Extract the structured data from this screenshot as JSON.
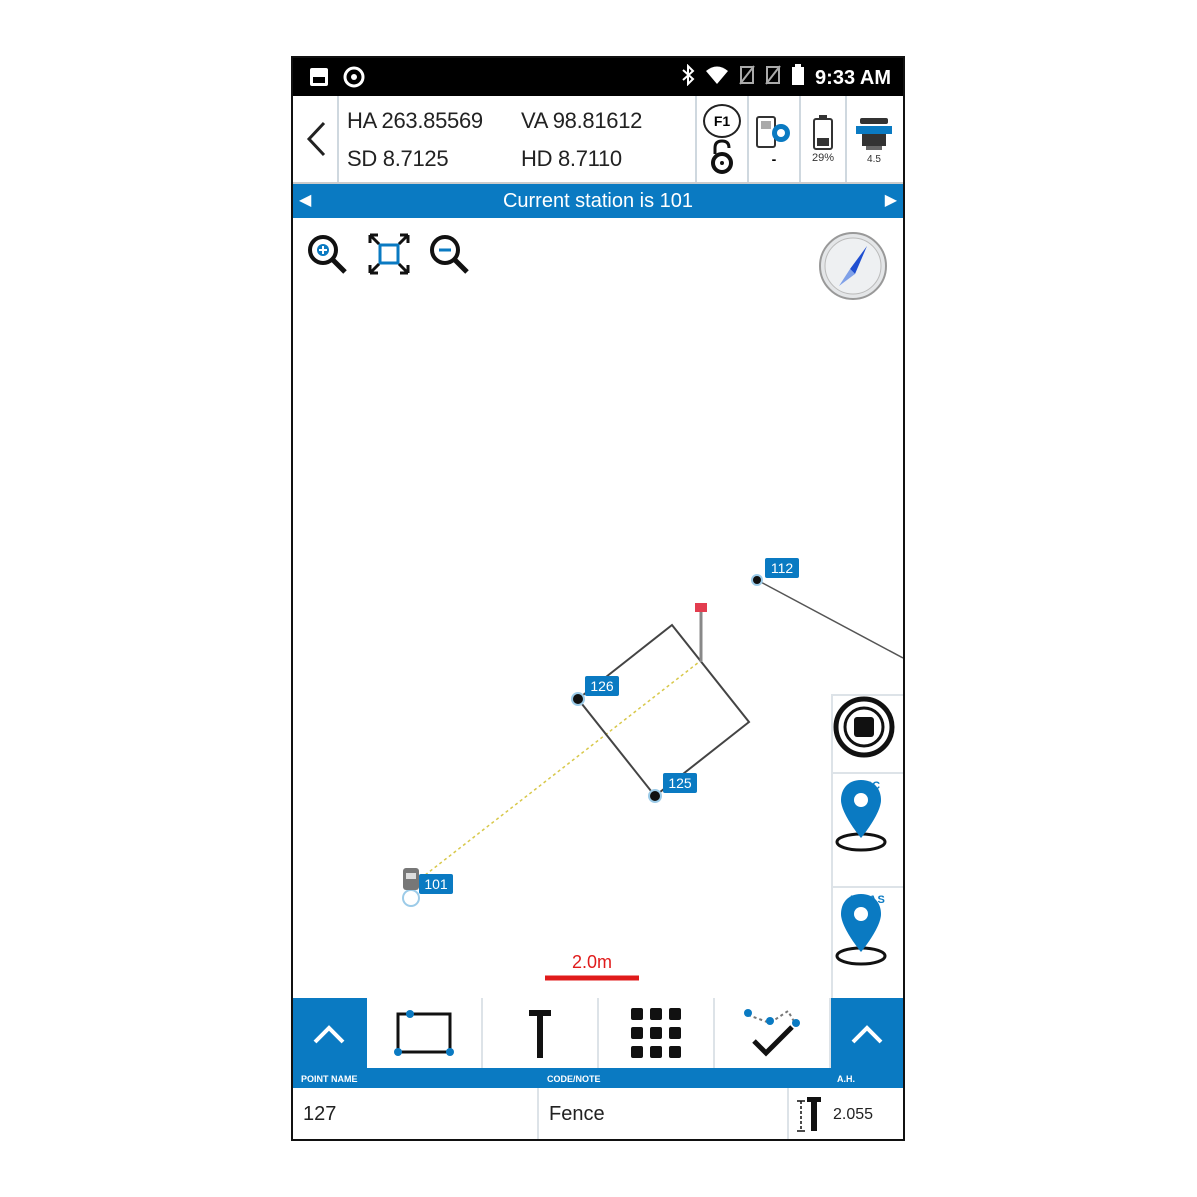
{
  "status_bar": {
    "time": "9:33 AM",
    "left_icons": [
      "image-icon",
      "target-icon"
    ],
    "right_icons": [
      "bluetooth-icon",
      "wifi-icon",
      "no-sim-icon",
      "no-sim-icon",
      "battery-icon"
    ]
  },
  "top_bar": {
    "ha": "HA 263.85569",
    "va": "VA 98.81612",
    "sd": "SD 8.7125",
    "hd": "HD 8.7110",
    "f1_label": "F1",
    "instrument_value": "-",
    "battery_percent": "29%",
    "prism_value": "4.5"
  },
  "station_bar": {
    "text": "Current station is 101"
  },
  "map": {
    "points": [
      {
        "name": "112"
      },
      {
        "name": "126"
      },
      {
        "name": "125"
      },
      {
        "name": "101"
      }
    ],
    "scale_label": "2.0m",
    "colors": {
      "accent": "#0a7ac2",
      "scale": "#e01b1b",
      "target": "#e33d4f"
    }
  },
  "side_buttons": {
    "rec_label": "REC",
    "meas_label": "MEAS"
  },
  "bottom_toolbar": {
    "tools": [
      "rectangle-tool",
      "pole-tool",
      "grid-tool",
      "check-points-tool"
    ]
  },
  "fields": {
    "point_name_label": "POINT NAME",
    "code_note_label": "CODE/NOTE",
    "ah_label": "A.H.",
    "point_name_value": "127",
    "code_value": "Fence",
    "ah_value": "2.055"
  }
}
